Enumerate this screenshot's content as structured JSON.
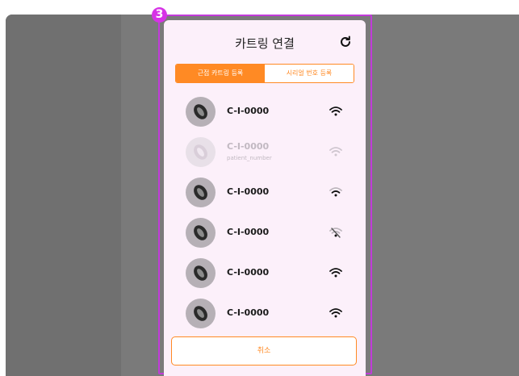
{
  "marker_label": "3",
  "modal": {
    "title": "카트링 연결",
    "refresh_icon": "refresh-icon"
  },
  "tabs": [
    {
      "label": "근접 카트링 등록",
      "active": true
    },
    {
      "label": "시리얼 번호 등록",
      "active": false
    }
  ],
  "devices": [
    {
      "id": "C-I-0000",
      "subtitle": "",
      "disabled": false,
      "signal": "wifi-strong-icon"
    },
    {
      "id": "C-I-0000",
      "subtitle": "patient_number",
      "disabled": true,
      "signal": "wifi-faded-icon"
    },
    {
      "id": "C-I-0000",
      "subtitle": "",
      "disabled": false,
      "signal": "wifi-medium-icon"
    },
    {
      "id": "C-I-0000",
      "subtitle": "",
      "disabled": false,
      "signal": "wifi-weak-icon"
    },
    {
      "id": "C-I-0000",
      "subtitle": "",
      "disabled": false,
      "signal": "wifi-strong-icon"
    },
    {
      "id": "C-I-0000",
      "subtitle": "",
      "disabled": false,
      "signal": "wifi-strong-icon"
    }
  ],
  "cancel_label": "취소",
  "colors": {
    "accent": "#ff8a24",
    "marker": "#d633e6",
    "modal_bg": "#fcf0fa",
    "overlay": "#7a7a7a"
  }
}
